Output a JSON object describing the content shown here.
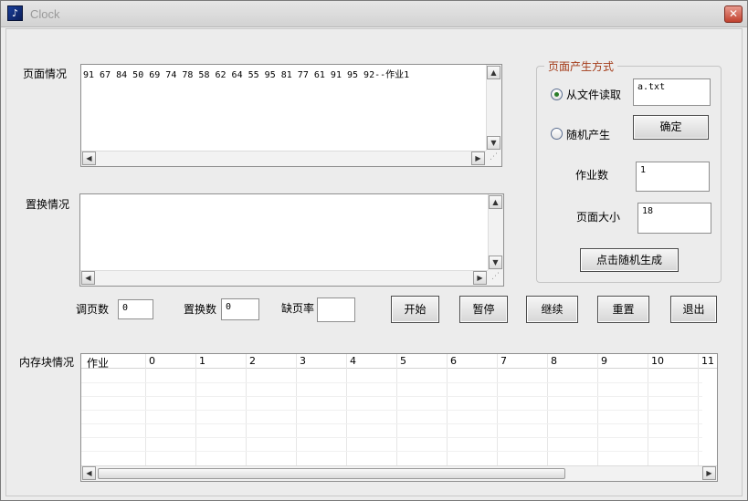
{
  "window": {
    "title": "Clock",
    "icon": "app-icon",
    "close_glyph": "✕"
  },
  "page_info": {
    "label": "页面情况",
    "content": "91 67 84 50 69 74 78 58 62 64 55 95 81 77 61 91 95 92--作业1"
  },
  "replace_info": {
    "label": "置换情况",
    "content": ""
  },
  "mode_group": {
    "title": "页面产生方式",
    "from_file_label": "从文件读取",
    "from_file_checked": true,
    "file_value": "a.txt",
    "random_label": "随机产生",
    "random_checked": false,
    "confirm_button": "确定",
    "job_count_label": "作业数",
    "job_count_value": "1",
    "page_size_label": "页面大小",
    "page_size_value": "18",
    "random_generate_button": "点击随机生成"
  },
  "stats": {
    "page_fetch_label": "调页数",
    "page_fetch_value": "0",
    "replace_count_label": "置换数",
    "replace_count_value": "0",
    "fault_rate_label": "缺页率",
    "fault_rate_value": ""
  },
  "controls": {
    "start": "开始",
    "pause": "暂停",
    "resume": "继续",
    "reset": "重置",
    "exit": "退出"
  },
  "memory": {
    "label": "内存块情况",
    "columns": [
      "作业",
      "0",
      "1",
      "2",
      "3",
      "4",
      "5",
      "6",
      "7",
      "8",
      "9",
      "10",
      "11"
    ]
  }
}
